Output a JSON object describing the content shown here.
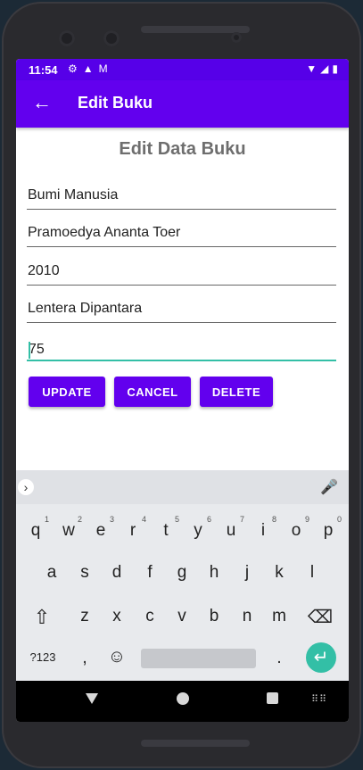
{
  "status": {
    "time": "11:54",
    "left_icons": [
      "⚙",
      "▲",
      "M"
    ],
    "right_icons": [
      "▼",
      "◢",
      "▮"
    ]
  },
  "appbar": {
    "back_icon": "←",
    "title": "Edit Buku"
  },
  "heading": "Edit Data Buku",
  "fields": {
    "judul": "Bumi Manusia",
    "penulis": "Pramoedya Ananta Toer",
    "tahun": "2010",
    "penerbit": "Lentera Dipantara",
    "harga": "75"
  },
  "buttons": {
    "update": "UPDATE",
    "cancel": "CANCEL",
    "delete": "DELETE"
  },
  "keyboard": {
    "row1": [
      "q",
      "w",
      "e",
      "r",
      "t",
      "y",
      "u",
      "i",
      "o",
      "p"
    ],
    "row1_hints": [
      "1",
      "2",
      "3",
      "4",
      "5",
      "6",
      "7",
      "8",
      "9",
      "0"
    ],
    "row2": [
      "a",
      "s",
      "d",
      "f",
      "g",
      "h",
      "j",
      "k",
      "l"
    ],
    "row3": [
      "z",
      "x",
      "c",
      "v",
      "b",
      "n",
      "m"
    ],
    "symbols": "?123",
    "comma": ",",
    "emoji": "☺",
    "period": ".",
    "shift": "⇧",
    "backspace": "⌫",
    "enter": "↵",
    "chevron": "›",
    "mic": "🎤"
  },
  "colors": {
    "primary": "#6200ee",
    "statusbar": "#5600e8",
    "accent": "#33bfa6"
  }
}
